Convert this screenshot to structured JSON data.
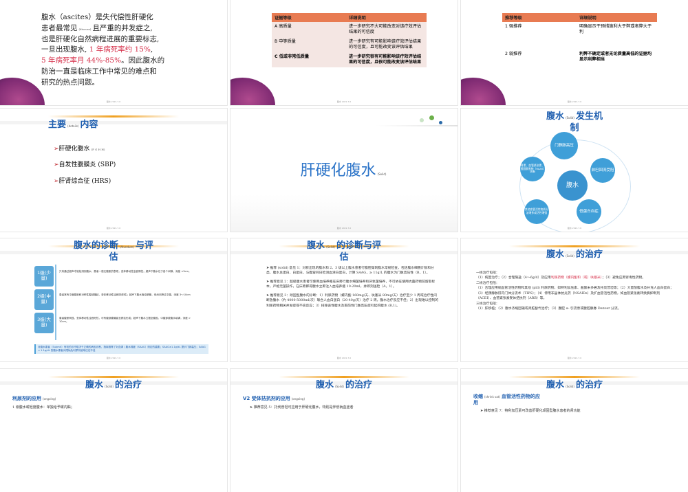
{
  "slides": {
    "s1": {
      "line1": "腹水（ascites）是失代偿性肝硬化",
      "line2a": "患者最常见",
      "line2_small": "(discuss)",
      "line2b": "且严重的并发症之,",
      "line3": "也是肝硬化自然病程进展的重要标志,",
      "line4a": "一旦出现腹水,",
      "line4red": "1 年病死率约 15%",
      "line4b": ",",
      "line5red": "5 年病死率月 44%-85%",
      "line5b": "。因此腹水的",
      "line6": "防治一直是临床工作中常见的难点和",
      "line7": "研究的热点问题。",
      "page": "腹水 2021.7.6"
    },
    "s2": {
      "header_col1": "证据等级",
      "header_col2": "详细说明",
      "rows": [
        {
          "grade": "A 高质量",
          "desc": "进一步研究不大可能改变对该疗效评估结果的可信度",
          "bold": false
        },
        {
          "grade": "B 中等质量",
          "desc": "进一步研究有可能影响该疗效评估结果的可信度，且可能改变该评估结果",
          "bold": false
        },
        {
          "grade": "C 低或非常低质量",
          "desc": "进一步研究很有可能影响该疗效评估结果的可信度，且很可能改变该评估结果",
          "bold": true
        }
      ],
      "page": "腹水 2021.7.6"
    },
    "s3": {
      "header_col1": "推荐等级",
      "header_col2": "详细说明",
      "rows": [
        {
          "grade": "1 强推荐",
          "desc": "明确显示干预措施利大于弊或者弊大于利",
          "bold": false
        },
        {
          "grade": "2 弱推荐",
          "desc": "利弊不确定或者无论质量高低的证据均显示利弊相当",
          "bold": true
        }
      ],
      "page": "腹水 2021.7.6"
    },
    "s4": {
      "title_a": "主要",
      "title_small": "(details)",
      "title_b": "内容",
      "items": [
        {
          "text": "肝硬化腹水",
          "small": "(F G H H)"
        },
        {
          "text": "自发性腹膜炎 (SBP)",
          "small": ""
        },
        {
          "text": "肝肾综合征 (HRS)",
          "small": ""
        }
      ],
      "page": "腹水 2021.7.6"
    },
    "s5": {
      "title": "肝硬化腹水",
      "small": "(Solid)",
      "page": "腹水 2021.7.6"
    },
    "s6": {
      "title_a": "腹水",
      "title_small": "(Solid)",
      "title_b": "发生机",
      "title_c": "制",
      "center": "腹水",
      "nodes": {
        "top": "门静脉高压",
        "right": "淋巴回流受阻",
        "bottom": "低蛋白血症",
        "left_bottom": "其他血管活性物质分泌增多或活性增强",
        "left_top": "肾素、血管紧张素、醛固酮系统（RAAS）失衡"
      },
      "page": "腹水 2021.7.6"
    },
    "s7": {
      "title_a": "腹水的诊断",
      "title_small": "(Alundum)",
      "title_b": "与评",
      "title_c": "估",
      "levels": [
        {
          "label": "1级(少量)",
          "desc": "只有通过超声才能检测到腹水，患者一般无腹胀的表现，查体移动性浊音阴性；超声下腹水位于各个间隙，深度 <3cm。"
        },
        {
          "label": "2级(中量)",
          "desc": "患者常有中度腹胀和对称性腹部隆起，查体移动性浊音阴/阳性；超声下腹水淹没肠管，但尚未跨过中腹，深度 3～10cm"
        },
        {
          "label": "3级(大量)",
          "desc": "患者腹胀明显，查体移动性浊音阳性，可有腹部膨隆甚至脐疝形成；超声下腹水占据全腹腔，中腹部被腹水填满，深度 > 10cm。"
        }
      ],
      "note": "对腹水患者（Submit）有较的诊疗取决于正确的病因诊断，指南推荐了对血清 / 腹水梯度（SAAG）测定的重要；SAAG≥1.1g/dL 提示门脉高压；SAAG < 1.1g/dL 的腹水患者对限钠及利尿剂使用往往不佳",
      "page": "腹水 2021.7.6"
    },
    "s8": {
      "title_a": "腹水",
      "title_small": "(Solid)",
      "title_b": "的诊断与评",
      "title_c": "估",
      "p1": "➤ 推荐 (solid) 意见 1：对新出现的腹水和 2、3 级以上腹水患者行腹腔穿刺腹水常规检查，包括腹水细胞计数和分类、腹水总蛋白、白蛋白，与腹穿同日检测血清白蛋白，计算 SAAG，≥ 11g/L 的腹水为门脉高压性（B，1）。",
      "p2": "➤ 推荐意见 2：超级腹水患者可使用血培养瓶在床旁行腹水细菌培养和厌氧菌培养，不可依在使用抗菌药物前留取标本，严格无菌操作，在床旁即得腹水立即注入血培养瓶 10-20ml，并即刻送检（A，1）。",
      "p3": "➤ 推荐意见 3：顽固型腹水的诊断：1）利尿药物（螺内酯 160mg/天、呋塞米 80mg/天）治疗至少 1 周或治疗性间断放腹水（约 4000-5000ml/次）联合人血白蛋白（20-40g/天）治疗 2 周，腹水治疗反应不佳；2）出现难以控制的利尿药物相关并发症或不良反应；3）排除恶性腹水及窦前性门脉高压症引起的腹水 (B,1)。",
      "page": "腹水 2021.7.6"
    },
    "s9": {
      "title_a": "腹水",
      "title_small": "(Solid)",
      "title_b": "的治疗",
      "l1": "一线治疗包括：",
      "l2a": "（1）病因治疗；（2）合理限盐（4～6g/d）及应用",
      "l2red": "利尿药物（螺内酯和（或）呋塞米）",
      "l2b": "；（3）避免应用肾毒性药物。",
      "l3": "二线治疗包括：",
      "l4": "（1）合理应用缩血管活性药物和其他 (pill) 利尿药物，如特利加压素、盐酸米多君及托伐普坦等；（2）大量放腹水及补充人血白蛋白；（3）经颈静脉肝内门体分流术（TIPS）；（4）停用非甾体抗炎药（NSAIDs）及扩血管活性药物，如血管紧张素转换酶抑制剂（ACEI）、血管紧张素受体拮抗剂（ARB）等。",
      "l5": "三线治疗包括：",
      "l6": "（1）肝移植；（2）腹水浓缩回输或肾脏替代治疗；（3）腹腔 α- 引流泵或腹腔静脉 Denver 分流。",
      "page": "腹水 2021.7.6"
    },
    "s10": {
      "title_a": "腹水",
      "title_small": "(Solid)",
      "title_b": "的治疗",
      "sub": "利尿剂的应用",
      "sub_small": "(ongoing)",
      "line": "1 级腹水或轻度腹水：单独给予螺内酯；"
    },
    "s11": {
      "title_a": "腹水",
      "title_small": "(Solid)",
      "title_b": "的治疗",
      "sub": "V2 受体拮抗剂的应用",
      "sub_small": "(ongoing)",
      "line": "➤ 推荐意见 5：托伐普坦可应用于肝硬化腹水，特别是伴低钠血症者"
    },
    "s12": {
      "title_a": "腹水",
      "title_small": "(Solid)",
      "title_b": "的治疗",
      "sub_a": "收缩",
      "sub_small": "(shrink vat)",
      "sub_b": "血管活性药物的应",
      "sub_c": "用",
      "line": "➤ 推荐意见 7：特利加压素可改善肝硬化顽固型腹水患者的肾功能"
    }
  }
}
